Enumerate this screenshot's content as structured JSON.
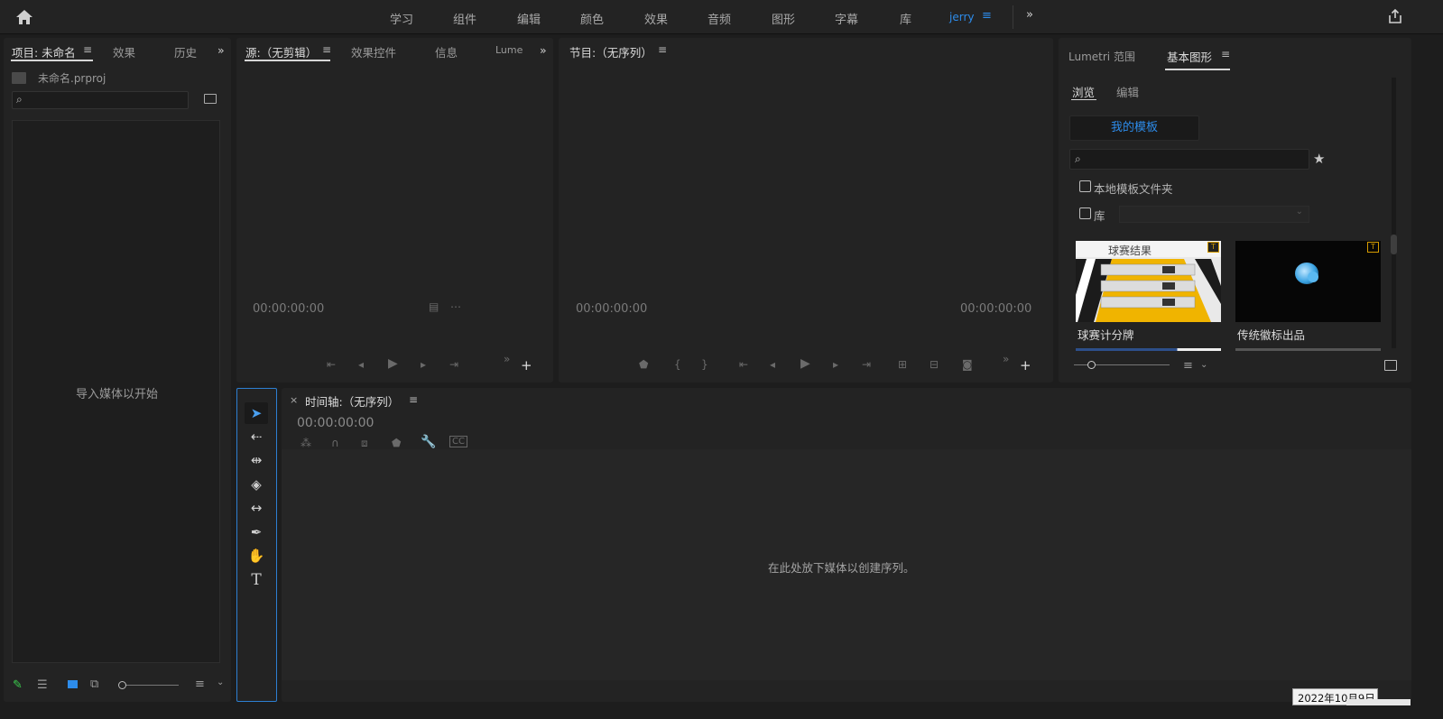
{
  "topbar": {
    "workspaces": [
      "学习",
      "组件",
      "编辑",
      "颜色",
      "效果",
      "音频",
      "图形",
      "字幕",
      "库",
      "jerry"
    ],
    "active_workspace": "jerry",
    "accent": "#2d8ceb"
  },
  "project_panel": {
    "tabs": [
      "项目: 未命名",
      "效果",
      "历史"
    ],
    "file_name": "未命名.prproj",
    "search_placeholder": "",
    "empty_message": "导入媒体以开始"
  },
  "source_panel": {
    "tabs": [
      "源:（无剪辑）",
      "效果控件",
      "信息",
      "Lume"
    ],
    "timecode": "00:00:00:00"
  },
  "program_panel": {
    "title": "节目:（无序列）",
    "timecode_left": "00:00:00:00",
    "timecode_right": "00:00:00:00"
  },
  "essential_graphics": {
    "tabs": [
      "Lumetri 范围",
      "基本图形"
    ],
    "subtabs": [
      "浏览",
      "编辑"
    ],
    "my_templates_button": "我的模板",
    "local_templates_label": "本地模板文件夹",
    "library_label": "库",
    "templates": [
      {
        "name": "球赛计分牌",
        "thumb_title": "球赛结果"
      },
      {
        "name": "传统徽标出品",
        "thumb_title": ""
      }
    ]
  },
  "timeline_panel": {
    "title": "时间轴:（无序列）",
    "timecode": "00:00:00:00",
    "empty_message": "在此处放下媒体以创建序列。"
  },
  "taskbar": {
    "date_fragment": "2022年10月9日"
  }
}
